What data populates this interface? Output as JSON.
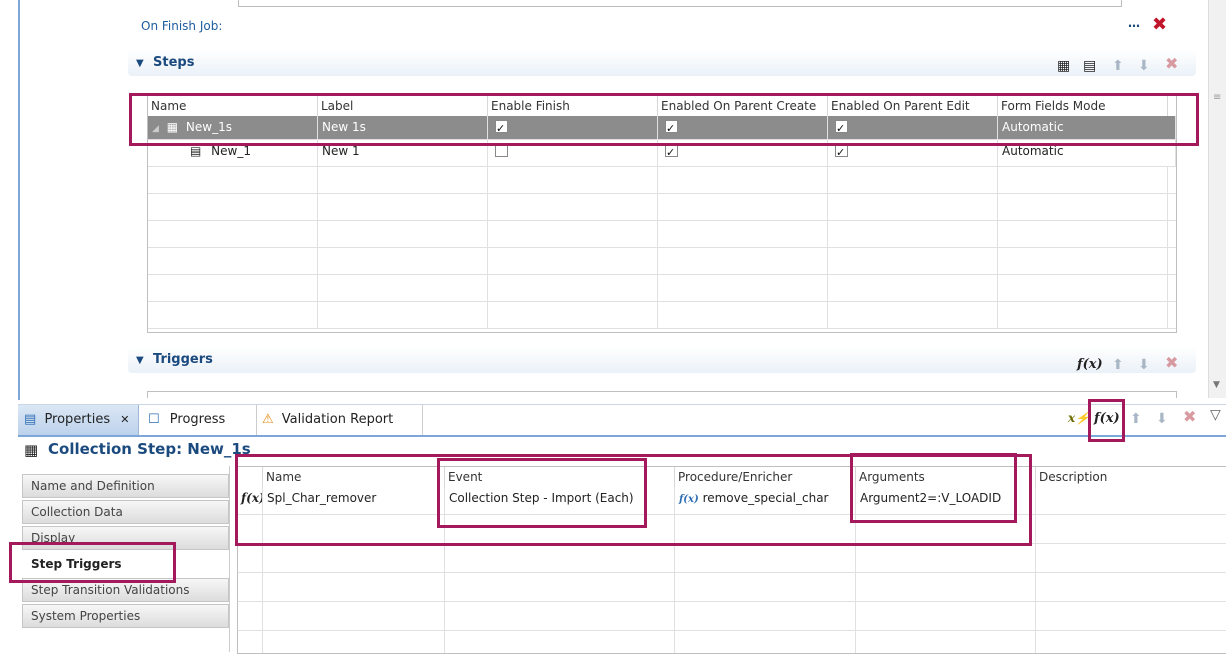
{
  "on_finish_job": {
    "label": "On Finish Job:",
    "ellipsis": "…"
  },
  "steps": {
    "title": "Steps",
    "columns": [
      "Name",
      "Label",
      "Enable Finish",
      "Enabled On Parent Create",
      "Enabled On Parent Edit",
      "Form Fields Mode"
    ],
    "rows": [
      {
        "name": "New_1s",
        "label": "New 1s",
        "enable_finish": true,
        "on_parent_create": true,
        "on_parent_edit": true,
        "mode": "Automatic",
        "selected": true
      },
      {
        "name": "New_1",
        "label": "New 1",
        "enable_finish": false,
        "on_parent_create": true,
        "on_parent_edit": true,
        "mode": "Automatic",
        "selected": false
      }
    ]
  },
  "triggers": {
    "title": "Triggers"
  },
  "bottom_tabs": [
    {
      "label": "Properties",
      "active": true
    },
    {
      "label": "Progress",
      "active": false
    },
    {
      "label": "Validation Report",
      "active": false
    }
  ],
  "collection_step": {
    "title": "Collection Step: New_1s"
  },
  "side_nav": [
    {
      "label": "Name and Definition",
      "active": false
    },
    {
      "label": "Collection Data",
      "active": false
    },
    {
      "label": "Display",
      "active": false
    },
    {
      "label": "Step Triggers",
      "active": true
    },
    {
      "label": "Step Transition Validations",
      "active": false
    },
    {
      "label": "System Properties",
      "active": false
    }
  ],
  "trigger_table": {
    "columns": [
      "Name",
      "Event",
      "Procedure/Enricher",
      "Arguments",
      "Description"
    ],
    "rows": [
      {
        "name": "Spl_Char_remover",
        "event": "Collection Step - Import (Each)",
        "procedure": "remove_special_char",
        "arguments": "Argument2=:V_LOADID",
        "description": ""
      }
    ]
  },
  "icons": {
    "fx": "f(x)",
    "close": "✖",
    "up": "⬆",
    "down": "⬇",
    "warning": "⚠",
    "menu": "▽"
  },
  "colors": {
    "annotation": "#a3195b",
    "section_title": "#1b4a7f",
    "selected_row": "#8c8c8c"
  }
}
